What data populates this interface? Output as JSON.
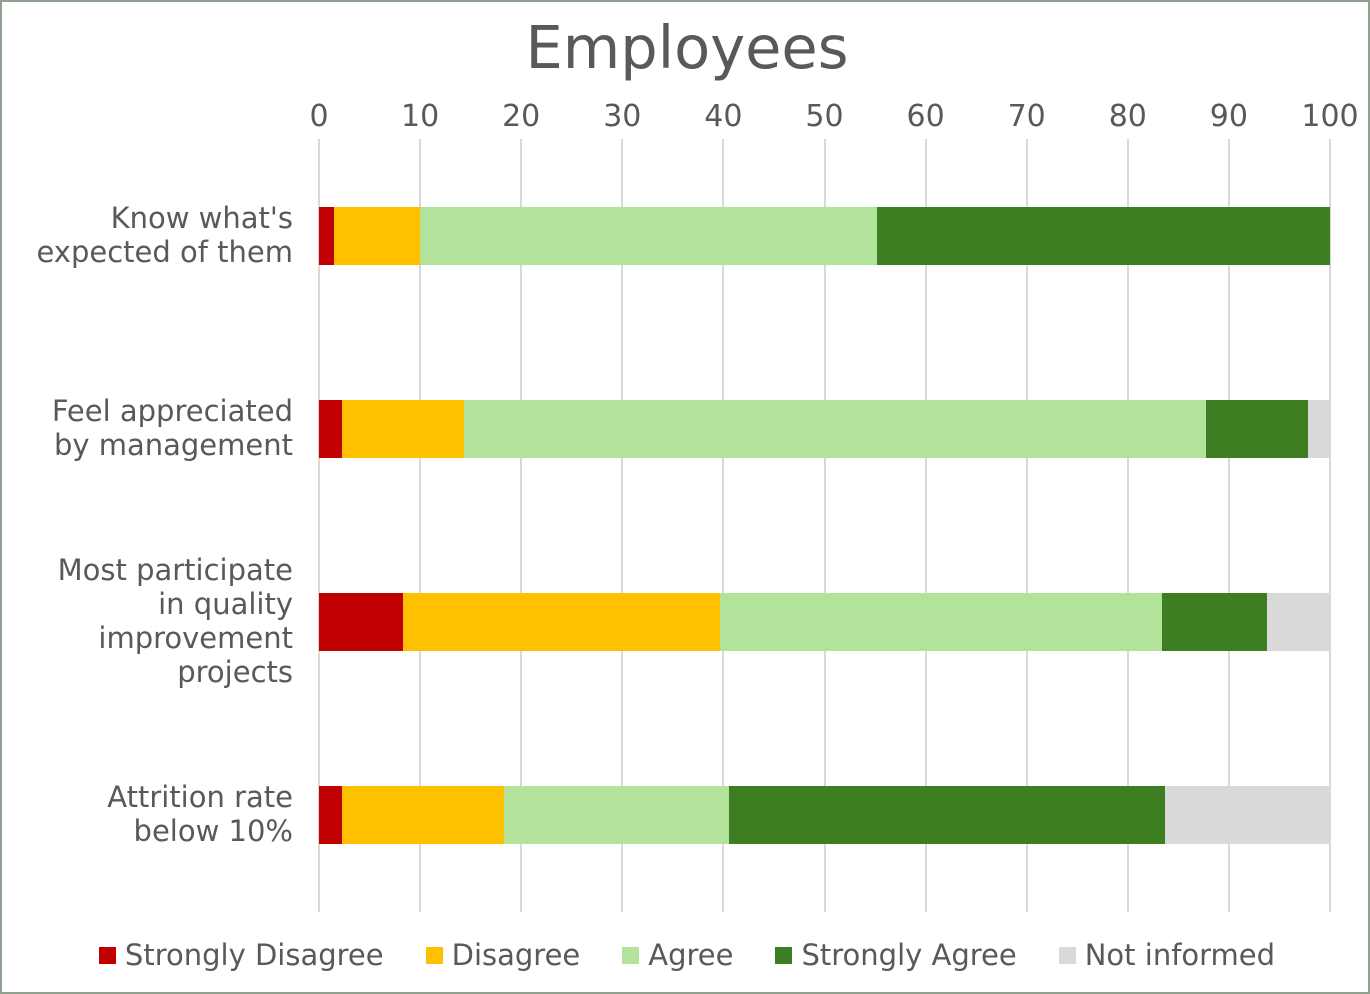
{
  "chart_data": {
    "type": "bar",
    "orientation": "horizontal",
    "stacked": true,
    "stack_mode": "absolute",
    "title": "Employees",
    "xlabel": "",
    "ylabel": "",
    "xlim": [
      0,
      100
    ],
    "xticks": [
      0,
      10,
      20,
      30,
      40,
      50,
      60,
      70,
      80,
      90,
      100
    ],
    "xtick_labels": [
      "0",
      "10",
      "20",
      "30",
      "40",
      "50",
      "60",
      "70",
      "80",
      "90",
      "100"
    ],
    "grid": "vertical",
    "legend_position": "bottom",
    "categories": [
      "Know what's expected of them",
      "Feel appreciated by management",
      "Most participate in quality improvement projects",
      "Attrition rate below 10%"
    ],
    "category_lines": [
      [
        "Know what's",
        "expected of them"
      ],
      [
        "Feel appreciated",
        "by management"
      ],
      [
        "Most participate",
        "in quality",
        "improvement projects"
      ],
      [
        "Attrition rate",
        "below 10%"
      ]
    ],
    "series": [
      {
        "name": "Strongly Disagree",
        "color": "#C00000",
        "values": [
          1.5,
          2.3,
          8.3,
          2.3
        ]
      },
      {
        "name": "Disagree",
        "color": "#FFC000",
        "values": [
          8.5,
          12.0,
          31.4,
          16.0
        ]
      },
      {
        "name": "Agree",
        "color": "#B3E39A",
        "values": [
          45.2,
          73.4,
          43.7,
          22.3
        ]
      },
      {
        "name": "Strongly Agree",
        "color": "#3E7E22",
        "values": [
          44.8,
          10.1,
          10.4,
          43.1
        ]
      },
      {
        "name": "Not informed",
        "color": "#D9D9D9",
        "values": [
          0,
          2.2,
          6.2,
          16.3
        ]
      }
    ]
  },
  "legend": {
    "items": [
      {
        "label": "Strongly Disagree",
        "color": "#C00000"
      },
      {
        "label": "Disagree",
        "color": "#FFC000"
      },
      {
        "label": "Agree",
        "color": "#B3E39A"
      },
      {
        "label": "Strongly Agree",
        "color": "#3E7E22"
      },
      {
        "label": "Not informed",
        "color": "#D9D9D9"
      }
    ]
  },
  "style": {
    "gridline_color": "#D9D9D9",
    "text_color": "#595959",
    "frame_border_color": "#8FA08F",
    "background": "#FFFFFF"
  }
}
